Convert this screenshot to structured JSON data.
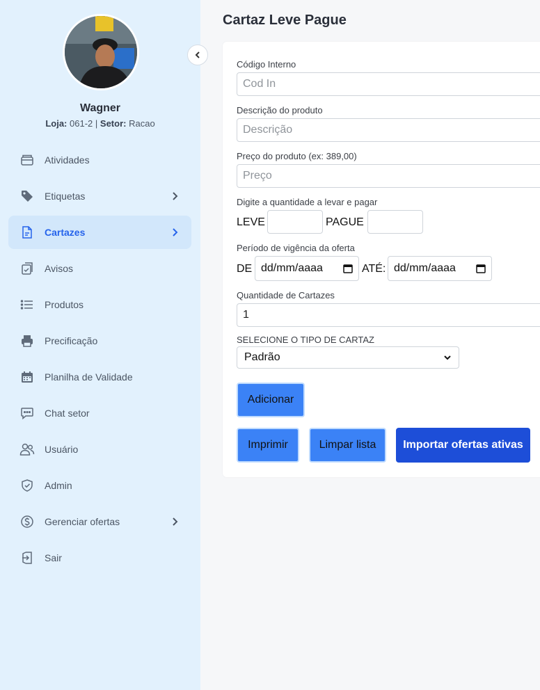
{
  "sidebar": {
    "user": {
      "name": "Wagner",
      "loja_label": "Loja:",
      "loja_value": "061-2",
      "separator": "|",
      "setor_label": "Setor:",
      "setor_value": "Racao"
    },
    "items": [
      {
        "label": "Atividades",
        "icon": "inbox-icon",
        "chevron": false,
        "active": false
      },
      {
        "label": "Etiquetas",
        "icon": "tag-icon",
        "chevron": true,
        "active": false
      },
      {
        "label": "Cartazes",
        "icon": "file-icon",
        "chevron": true,
        "active": true
      },
      {
        "label": "Avisos",
        "icon": "clipboard-check-icon",
        "chevron": false,
        "active": false
      },
      {
        "label": "Produtos",
        "icon": "list-icon",
        "chevron": false,
        "active": false
      },
      {
        "label": "Precificação",
        "icon": "printer-icon",
        "chevron": false,
        "active": false
      },
      {
        "label": "Planilha de Validade",
        "icon": "calendar-icon",
        "chevron": false,
        "active": false
      },
      {
        "label": "Chat setor",
        "icon": "chat-icon",
        "chevron": false,
        "active": false
      },
      {
        "label": "Usuário",
        "icon": "users-icon",
        "chevron": false,
        "active": false
      },
      {
        "label": "Admin",
        "icon": "shield-check-icon",
        "chevron": false,
        "active": false
      },
      {
        "label": "Gerenciar ofertas",
        "icon": "dollar-circle-icon",
        "chevron": true,
        "active": false
      },
      {
        "label": "Sair",
        "icon": "logout-icon",
        "chevron": false,
        "active": false
      }
    ]
  },
  "main": {
    "title": "Cartaz Leve Pague",
    "form": {
      "codigo_label": "Código Interno",
      "codigo_placeholder": "Cod In",
      "descricao_label": "Descrição do produto",
      "descricao_placeholder": "Descrição",
      "preco_label": "Preço do produto (ex: 389,00)",
      "preco_placeholder": "Preço",
      "quantidade_label": "Digite a quantidade a levar e pagar",
      "leve_label": "LEVE",
      "pague_label": "PAGUE",
      "periodo_label": "Período de vigência da oferta",
      "de_label": "DE",
      "ate_label": "ATÉ:",
      "date_placeholder": "dd/mm/aaaa",
      "qtd_cartazes_label": "Quantidade de Cartazes",
      "qtd_cartazes_value": "1",
      "tipo_label": "SELECIONE O TIPO DE CARTAZ",
      "tipo_value": "Padrão"
    },
    "buttons": {
      "adicionar": "Adicionar",
      "imprimir": "Imprimir",
      "limpar": "Limpar lista",
      "importar": "Importar ofertas ativas"
    }
  },
  "colors": {
    "sidebar_bg": "#e2f1fd",
    "accent": "#2563eb",
    "button": "#3b82f6",
    "button_dark": "#1d4ed8"
  }
}
